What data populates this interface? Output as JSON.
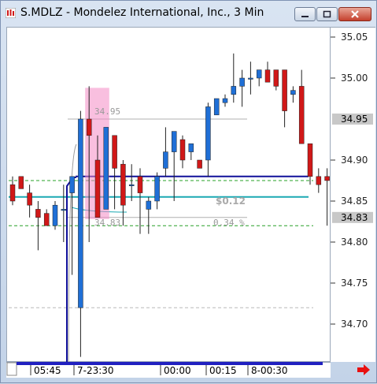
{
  "window": {
    "title": "S.MDLZ - Mondelez International, Inc., 3 Min"
  },
  "colors": {
    "up": "#1f6fd6",
    "down": "#d01818",
    "highlight": "#f48bc4",
    "navy": "#10109a",
    "teal": "#1ba9b3",
    "green_dash": "#27a027"
  },
  "chart_data": {
    "type": "candlestick",
    "y_ticks": [
      "35.05",
      "35.00",
      "34.90",
      "34.85",
      "34.80",
      "34.75",
      "34.70"
    ],
    "ylim": [
      34.66,
      35.08
    ],
    "x_ticks": [
      "05:45",
      "7-23:30",
      "00:00",
      "00:15",
      "8-00:30"
    ],
    "price_tags": [
      "34.95",
      "34.83"
    ],
    "annotations": {
      "high_label": "34.95",
      "low_label": "34.83",
      "diff_label": "$0.12",
      "pct_label": "0.34 %"
    },
    "levels": {
      "navy": 34.88,
      "teal": 34.855,
      "green_upper": 34.875,
      "green_lower": 34.82,
      "gray_bottom": 34.72,
      "range_high": 34.95,
      "range_low": 34.83
    },
    "candles": [
      {
        "o": 34.87,
        "h": 34.88,
        "l": 34.845,
        "c": 34.85
      },
      {
        "o": 34.88,
        "h": 34.88,
        "l": 34.865,
        "c": 34.865
      },
      {
        "o": 34.86,
        "h": 34.87,
        "l": 34.83,
        "c": 34.845
      },
      {
        "o": 34.84,
        "h": 34.85,
        "l": 34.79,
        "c": 34.83
      },
      {
        "o": 34.835,
        "h": 34.84,
        "l": 34.82,
        "c": 34.82
      },
      {
        "o": 34.82,
        "h": 34.85,
        "l": 34.815,
        "c": 34.845
      },
      {
        "o": 34.84,
        "h": 34.87,
        "l": 34.8,
        "c": 34.84
      },
      {
        "o": 34.86,
        "h": 34.875,
        "l": 34.76,
        "c": 34.88
      },
      {
        "o": 34.72,
        "h": 34.96,
        "l": 34.66,
        "c": 34.95
      },
      {
        "o": 34.95,
        "h": 34.99,
        "l": 34.8,
        "c": 34.93
      },
      {
        "o": 34.9,
        "h": 34.93,
        "l": 34.84,
        "c": 34.83
      },
      {
        "o": 34.84,
        "h": 34.94,
        "l": 34.84,
        "c": 34.94
      },
      {
        "o": 34.93,
        "h": 34.93,
        "l": 34.84,
        "c": 34.89
      },
      {
        "o": 34.895,
        "h": 34.9,
        "l": 34.82,
        "c": 34.845
      },
      {
        "o": 34.87,
        "h": 34.895,
        "l": 34.85,
        "c": 34.87
      },
      {
        "o": 34.88,
        "h": 34.89,
        "l": 34.81,
        "c": 34.86
      },
      {
        "o": 34.84,
        "h": 34.855,
        "l": 34.81,
        "c": 34.85
      },
      {
        "o": 34.85,
        "h": 34.885,
        "l": 34.84,
        "c": 34.88
      },
      {
        "o": 34.89,
        "h": 34.94,
        "l": 34.88,
        "c": 34.91
      },
      {
        "o": 34.91,
        "h": 34.92,
        "l": 34.85,
        "c": 34.935
      },
      {
        "o": 34.925,
        "h": 34.93,
        "l": 34.89,
        "c": 34.9
      },
      {
        "o": 34.91,
        "h": 34.92,
        "l": 34.9,
        "c": 34.92
      },
      {
        "o": 34.9,
        "h": 34.9,
        "l": 34.89,
        "c": 34.89
      },
      {
        "o": 34.9,
        "h": 34.97,
        "l": 34.88,
        "c": 34.965
      },
      {
        "o": 34.955,
        "h": 34.975,
        "l": 34.955,
        "c": 34.975
      },
      {
        "o": 34.97,
        "h": 34.98,
        "l": 34.965,
        "c": 34.975
      },
      {
        "o": 34.98,
        "h": 35.03,
        "l": 34.97,
        "c": 34.99
      },
      {
        "o": 34.99,
        "h": 35.01,
        "l": 34.965,
        "c": 35.0
      },
      {
        "o": 35.0,
        "h": 35.02,
        "l": 34.98,
        "c": 35.0
      },
      {
        "o": 35.0,
        "h": 35.01,
        "l": 34.99,
        "c": 35.01
      },
      {
        "o": 35.01,
        "h": 35.02,
        "l": 35.0,
        "c": 34.995
      },
      {
        "o": 35.01,
        "h": 35.01,
        "l": 34.985,
        "c": 34.99
      },
      {
        "o": 35.01,
        "h": 35.01,
        "l": 34.94,
        "c": 34.96
      },
      {
        "o": 34.98,
        "h": 34.99,
        "l": 34.97,
        "c": 34.985
      },
      {
        "o": 34.99,
        "h": 35.01,
        "l": 34.92,
        "c": 34.92
      },
      {
        "o": 34.92,
        "h": 34.92,
        "l": 34.87,
        "c": 34.88
      },
      {
        "o": 34.88,
        "h": 34.89,
        "l": 34.86,
        "c": 34.87
      },
      {
        "o": 34.88,
        "h": 34.89,
        "l": 34.82,
        "c": 34.875
      }
    ]
  }
}
